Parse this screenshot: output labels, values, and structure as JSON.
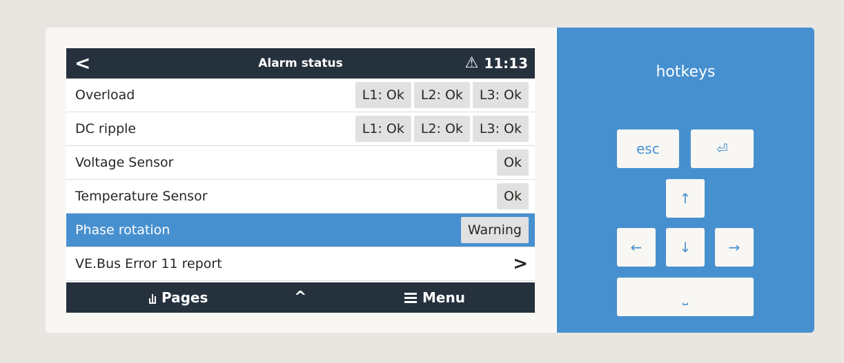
{
  "screen": {
    "header": {
      "title": "Alarm status",
      "time": "11:13",
      "warning_icon": "⚠"
    },
    "rows": [
      {
        "label": "Overload",
        "values": [
          "L1: Ok",
          "L2: Ok",
          "L3: Ok"
        ]
      },
      {
        "label": "DC ripple",
        "values": [
          "L1: Ok",
          "L2: Ok",
          "L3: Ok"
        ]
      },
      {
        "label": "Voltage Sensor",
        "values": [
          "Ok"
        ]
      },
      {
        "label": "Temperature Sensor",
        "values": [
          "Ok"
        ]
      },
      {
        "label": "Phase rotation",
        "values": [
          "Warning"
        ],
        "selected": true
      },
      {
        "label": "VE.Bus Error 11 report",
        "values": []
      }
    ],
    "footer": {
      "pages_label": "Pages",
      "menu_label": "Menu"
    }
  },
  "hotkeys": {
    "title": "hotkeys",
    "keys": {
      "esc": "esc",
      "enter": "⏎",
      "up": "↑",
      "left": "←",
      "down": "↓",
      "right": "→",
      "space": "⎵"
    }
  },
  "colors": {
    "accent": "#4790d0",
    "bar": "#26313e",
    "value_bg": "#e1e1e1"
  }
}
